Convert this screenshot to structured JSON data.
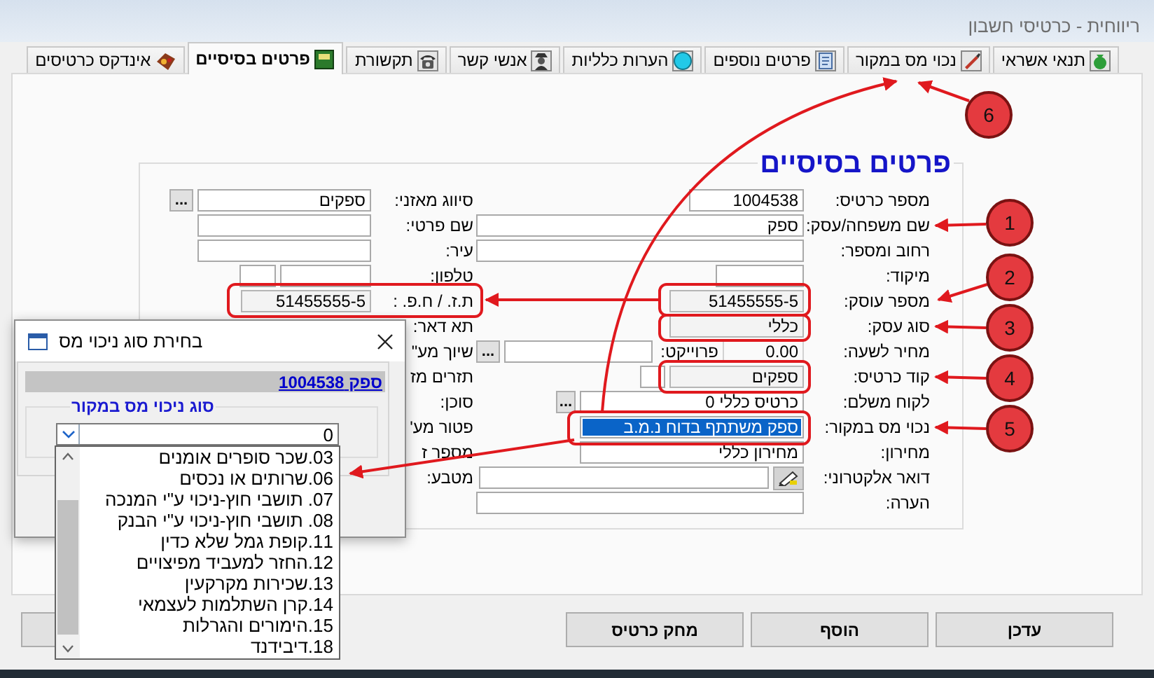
{
  "window": {
    "title": "ריווחית - כרטיסי חשבון"
  },
  "tabs": [
    {
      "label": "תנאי אשראי",
      "selected": false
    },
    {
      "label": "נכוי מס במקור",
      "selected": false
    },
    {
      "label": "פרטים נוספים",
      "selected": false
    },
    {
      "label": "הערות כלליות",
      "selected": false
    },
    {
      "label": "אנשי קשר",
      "selected": false
    },
    {
      "label": "תקשורת",
      "selected": false
    },
    {
      "label": "פרטים בסיסיים",
      "selected": true
    },
    {
      "label": "אינדקס כרטיסים",
      "selected": false
    }
  ],
  "heading": "פרטים בסיסיים",
  "right_rows": [
    {
      "label": "מספר כרטיס:",
      "parts": [
        {
          "kind": "field",
          "value": "1004538"
        }
      ]
    },
    {
      "label": "שם משפחה/עסק:",
      "parts": [
        {
          "kind": "field",
          "value": "ספק"
        }
      ]
    },
    {
      "label": "רחוב ומספר:",
      "parts": [
        {
          "kind": "field"
        }
      ]
    },
    {
      "label": "מיקוד:",
      "parts": [
        {
          "kind": "field"
        }
      ]
    },
    {
      "label": "מספר עוסק:",
      "parts": [
        {
          "kind": "readonly",
          "value": "51455555-5"
        }
      ]
    },
    {
      "label": "סוג עסק:",
      "parts": [
        {
          "kind": "readonly",
          "value": "כללי"
        }
      ]
    },
    {
      "label": "מחיר לשעה:",
      "parts": [
        {
          "kind": "readout",
          "value": "0.00"
        },
        {
          "kind": "label",
          "value": "פרוייקט:"
        },
        {
          "kind": "field"
        },
        {
          "kind": "dots",
          "value": "..."
        }
      ]
    },
    {
      "label": "קוד כרטיס:",
      "parts": [
        {
          "kind": "readonly",
          "value": "ספקים"
        },
        {
          "kind": "field"
        }
      ]
    },
    {
      "label": "לקוח משלם:",
      "parts": [
        {
          "kind": "field",
          "value": "כרטיס כללי 0"
        },
        {
          "kind": "dots",
          "value": "..."
        }
      ]
    },
    {
      "label": "נכוי מס במקור:",
      "parts": [
        {
          "kind": "highlighted",
          "value": "ספק משתתף בדוח נ.מ.ב"
        }
      ]
    },
    {
      "label": "מחירון:",
      "parts": [
        {
          "kind": "field",
          "value": "מחירון כללי"
        }
      ]
    },
    {
      "label": "דואר אלקטרוני:",
      "parts": [
        {
          "kind": "mail"
        },
        {
          "kind": "field"
        }
      ]
    },
    {
      "label": "הערה:",
      "parts": [
        {
          "kind": "field"
        }
      ]
    }
  ],
  "left_rows": [
    {
      "label": "סיווג מאזני:",
      "parts": [
        {
          "kind": "field",
          "value": "ספקים"
        },
        {
          "kind": "dots",
          "value": "..."
        }
      ]
    },
    {
      "label": "שם פרטי:",
      "parts": [
        {
          "kind": "field"
        }
      ]
    },
    {
      "label": "עיר:",
      "parts": [
        {
          "kind": "field"
        }
      ]
    },
    {
      "label": "טלפון:",
      "parts": [
        {
          "kind": "field"
        },
        {
          "kind": "field"
        }
      ]
    },
    {
      "label": "ת.ז. / ח.פ. :",
      "parts": [
        {
          "kind": "readonly",
          "value": "51455555-5"
        }
      ]
    },
    {
      "label": "תא דאר:",
      "parts": []
    },
    {
      "label": "שיוך מע\"",
      "parts": []
    },
    {
      "label": "תזרים מז",
      "parts": []
    },
    {
      "label": "סוכן:",
      "parts": []
    },
    {
      "label": "פטור מע'",
      "parts": []
    },
    {
      "label": "מספר ז",
      "parts": []
    },
    {
      "label": "מטבע:",
      "parts": []
    }
  ],
  "buttons": [
    "עדכן",
    "הוסף",
    "מחק כרטיס"
  ],
  "dialog": {
    "title": "בחירת סוג ניכוי מס",
    "link": "ספק 1004538",
    "group_title": "סוג ניכוי מס במקור",
    "combo_value": "0",
    "options": [
      "03.שכר סופרים אומנים",
      "06.שרותים או נכסים",
      "07. תושבי חוץ-ניכוי ע\"י המנכה",
      "08. תושבי חוץ-ניכוי ע\"י הבנק",
      "11.קופת גמל שלא כדין",
      "12.החזר למעביד מפיצויים",
      "13.שכירות מקרקעין",
      "14.קרן השתלמות לעצמאי",
      "15.הימורים והגרלות",
      "18.דיבידנד"
    ]
  },
  "callouts": [
    "1",
    "2",
    "3",
    "4",
    "5",
    "6"
  ]
}
